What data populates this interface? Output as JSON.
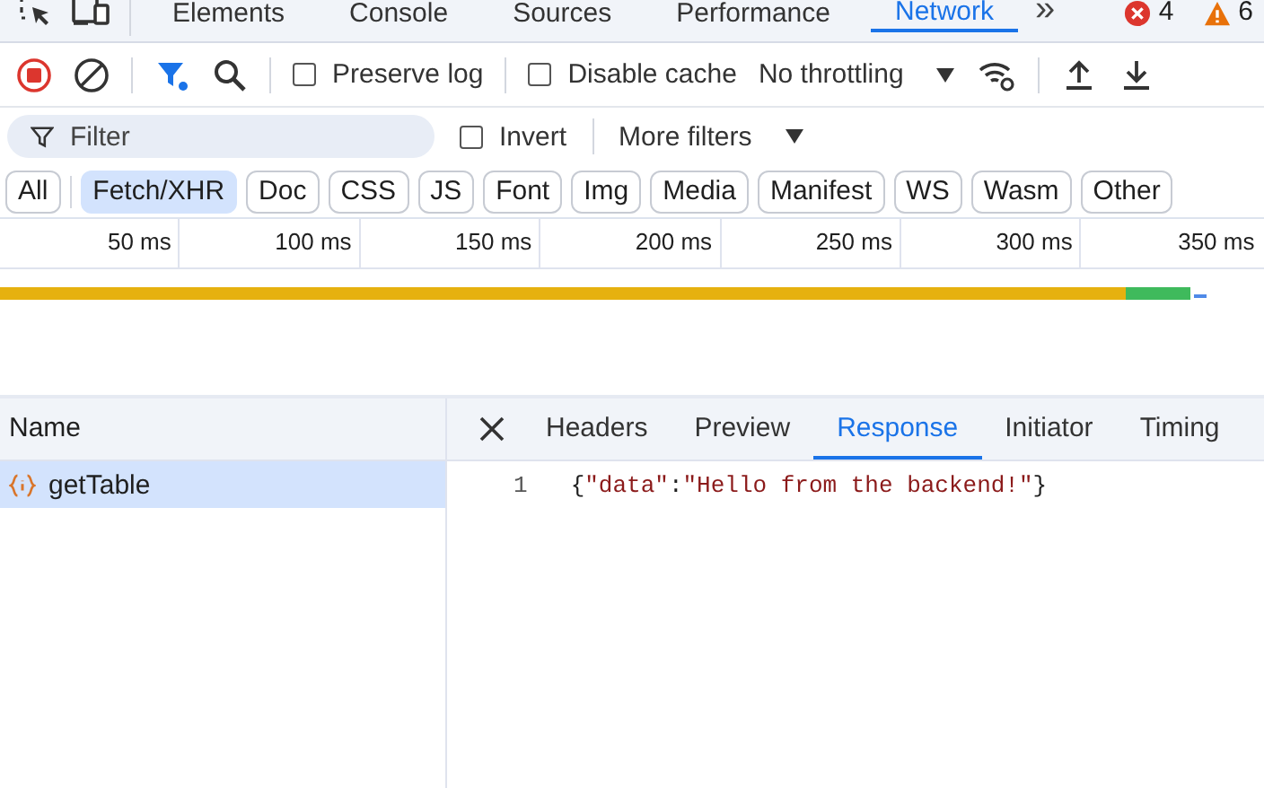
{
  "panel_tabs": [
    {
      "label": "Elements",
      "selected": false
    },
    {
      "label": "Console",
      "selected": false
    },
    {
      "label": "Sources",
      "selected": false
    },
    {
      "label": "Performance",
      "selected": false
    },
    {
      "label": "Network",
      "selected": true
    }
  ],
  "more_tabs": "»",
  "issues": {
    "errors": "4",
    "warnings": "6"
  },
  "toolbar": {
    "recording": true,
    "preserve_log": {
      "label": "Preserve log",
      "checked": false
    },
    "disable_cache": {
      "label": "Disable cache",
      "checked": false
    },
    "throttling": "No throttling"
  },
  "filter": {
    "placeholder": "Filter",
    "invert": {
      "label": "Invert",
      "checked": false
    },
    "more_filters": "More filters"
  },
  "type_filters": [
    {
      "label": "All",
      "selected": false
    },
    {
      "label": "Fetch/XHR",
      "selected": true
    },
    {
      "label": "Doc",
      "selected": false
    },
    {
      "label": "CSS",
      "selected": false
    },
    {
      "label": "JS",
      "selected": false
    },
    {
      "label": "Font",
      "selected": false
    },
    {
      "label": "Img",
      "selected": false
    },
    {
      "label": "Media",
      "selected": false
    },
    {
      "label": "Manifest",
      "selected": false
    },
    {
      "label": "WS",
      "selected": false
    },
    {
      "label": "Wasm",
      "selected": false
    },
    {
      "label": "Other",
      "selected": false
    }
  ],
  "timeline": {
    "ticks": [
      "50 ms",
      "100 ms",
      "150 ms",
      "200 ms",
      "250 ms",
      "300 ms",
      "350 ms"
    ]
  },
  "requests": {
    "column": "Name",
    "rows": [
      {
        "name": "getTable",
        "selected": true
      }
    ]
  },
  "details": {
    "tabs": [
      {
        "label": "Headers",
        "selected": false
      },
      {
        "label": "Preview",
        "selected": false
      },
      {
        "label": "Response",
        "selected": true
      },
      {
        "label": "Initiator",
        "selected": false
      },
      {
        "label": "Timing",
        "selected": false
      }
    ],
    "lines": [
      {
        "number": "1",
        "parts": [
          {
            "kind": "punct",
            "text": "{"
          },
          {
            "kind": "string",
            "text": "\"data\""
          },
          {
            "kind": "punct",
            "text": ":"
          },
          {
            "kind": "string",
            "text": "\"Hello from the backend!\""
          },
          {
            "kind": "punct",
            "text": "}"
          }
        ]
      }
    ]
  }
}
